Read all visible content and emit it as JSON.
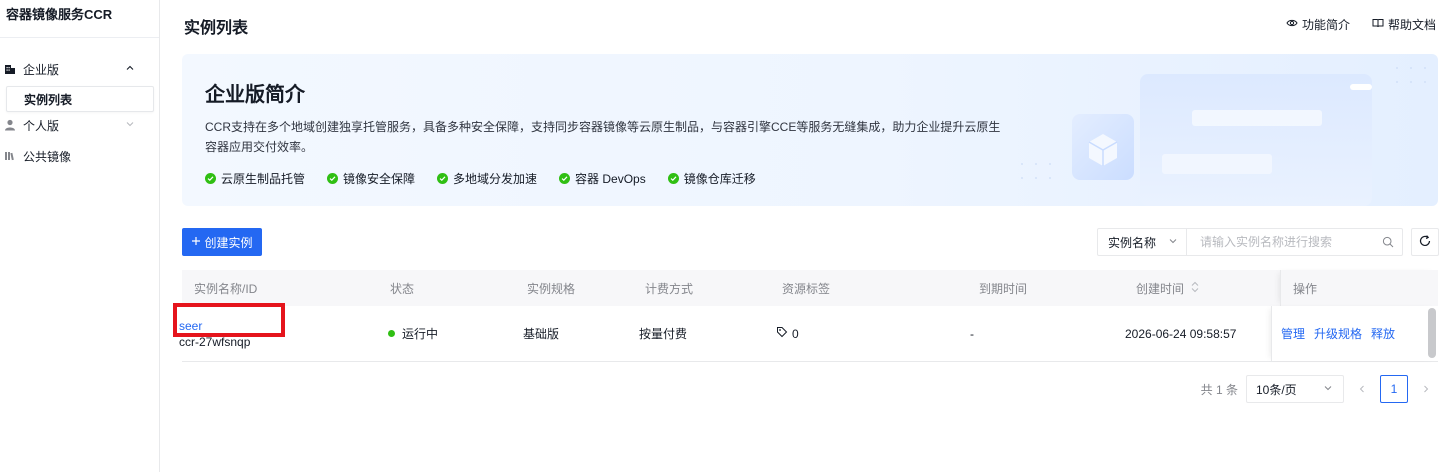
{
  "sidebar": {
    "brand": "容器镜像服务CCR",
    "groups": [
      {
        "label": "企业版",
        "icon": "building-icon",
        "expanded": true
      },
      {
        "label": "个人版",
        "icon": "user-icon",
        "expanded": false
      },
      {
        "label": "公共镜像",
        "icon": "library-icon"
      }
    ],
    "active_sub": "实例列表"
  },
  "header": {
    "title": "实例列表",
    "links": [
      {
        "label": "功能简介",
        "icon": "eye-icon"
      },
      {
        "label": "帮助文档",
        "icon": "book-icon"
      }
    ]
  },
  "banner": {
    "title": "企业版简介",
    "desc": "CCR支持在多个地域创建独享托管服务，具备多种安全保障，支持同步容器镜像等云原生制品，与容器引擎CCE等服务无缝集成，助力企业提升云原生容器应用交付效率。",
    "features": [
      "云原生制品托管",
      "镜像安全保障",
      "多地域分发加速",
      "容器 DevOps",
      "镜像仓库迁移"
    ]
  },
  "toolbar": {
    "create_label": "创建实例",
    "search_field": "实例名称",
    "search_placeholder": "请输入实例名称进行搜索"
  },
  "table": {
    "columns": [
      "实例名称/ID",
      "状态",
      "实例规格",
      "计费方式",
      "资源标签",
      "到期时间",
      "创建时间",
      "操作"
    ],
    "rows": [
      {
        "name": "seer",
        "id": "ccr-27wfsnqp",
        "status": "运行中",
        "spec": "基础版",
        "billing": "按量付费",
        "tags": "0",
        "expire": "-",
        "created": "2026-06-24 09:58:57",
        "actions": [
          "管理",
          "升级规格",
          "释放"
        ]
      }
    ]
  },
  "pagination": {
    "total": "共 1 条",
    "page_size": "10条/页",
    "current_page": "1"
  },
  "colors": {
    "primary": "#2468f2",
    "success": "#30bf13",
    "highlight": "#e5141c"
  }
}
